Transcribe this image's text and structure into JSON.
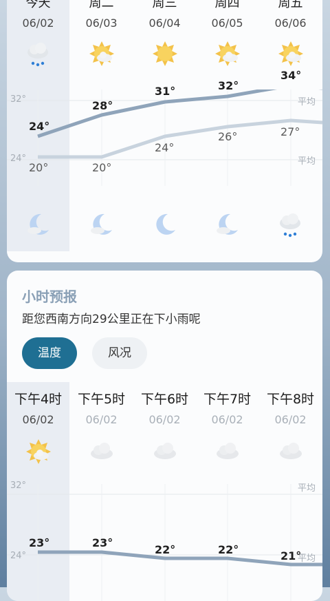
{
  "daily": {
    "avg_label": "平均",
    "axis": [
      "32°",
      "24°"
    ],
    "days": [
      {
        "name": "今天",
        "date": "06/02",
        "day_icon": "rain-cloud-icon",
        "high": "24°",
        "low": "20°",
        "night_icon": "moon-cloud-icon"
      },
      {
        "name": "周二",
        "date": "06/03",
        "day_icon": "sun-cloud-icon",
        "high": "28°",
        "low": "20°",
        "night_icon": "moon-cloud-icon"
      },
      {
        "name": "周三",
        "date": "06/04",
        "day_icon": "sun-icon",
        "high": "31°",
        "low": "24°",
        "night_icon": "moon-icon"
      },
      {
        "name": "周四",
        "date": "06/05",
        "day_icon": "sun-cloud-icon",
        "high": "32°",
        "low": "26°",
        "night_icon": "moon-cloud-icon"
      },
      {
        "name": "周五",
        "date": "06/06",
        "day_icon": "sun-cloud-icon",
        "high": "34°",
        "low": "27°",
        "night_icon": "rain-cloud-icon"
      }
    ]
  },
  "hourly": {
    "title": "小时预报",
    "subtitle": "距您西南方向29公里正在下小雨呢",
    "tabs": [
      "温度",
      "风况"
    ],
    "avg_label": "平均",
    "axis": [
      "32°",
      "24°"
    ],
    "hours": [
      {
        "name": "下午4时",
        "date": "06/02",
        "icon": "sun-cloud-icon",
        "temp": "23°"
      },
      {
        "name": "下午5时",
        "date": "06/02",
        "icon": "cloud-icon",
        "temp": "23°"
      },
      {
        "name": "下午6时",
        "date": "06/02",
        "icon": "cloud-icon",
        "temp": "22°"
      },
      {
        "name": "下午7时",
        "date": "06/02",
        "icon": "cloud-icon",
        "temp": "22°"
      },
      {
        "name": "下午8时",
        "date": "06/02",
        "icon": "cloud-icon",
        "temp": "21°"
      }
    ]
  },
  "colors": {
    "accent": "#1f6f93",
    "line_high": "#8fa4ba",
    "line_low": "#c8d3de"
  }
}
